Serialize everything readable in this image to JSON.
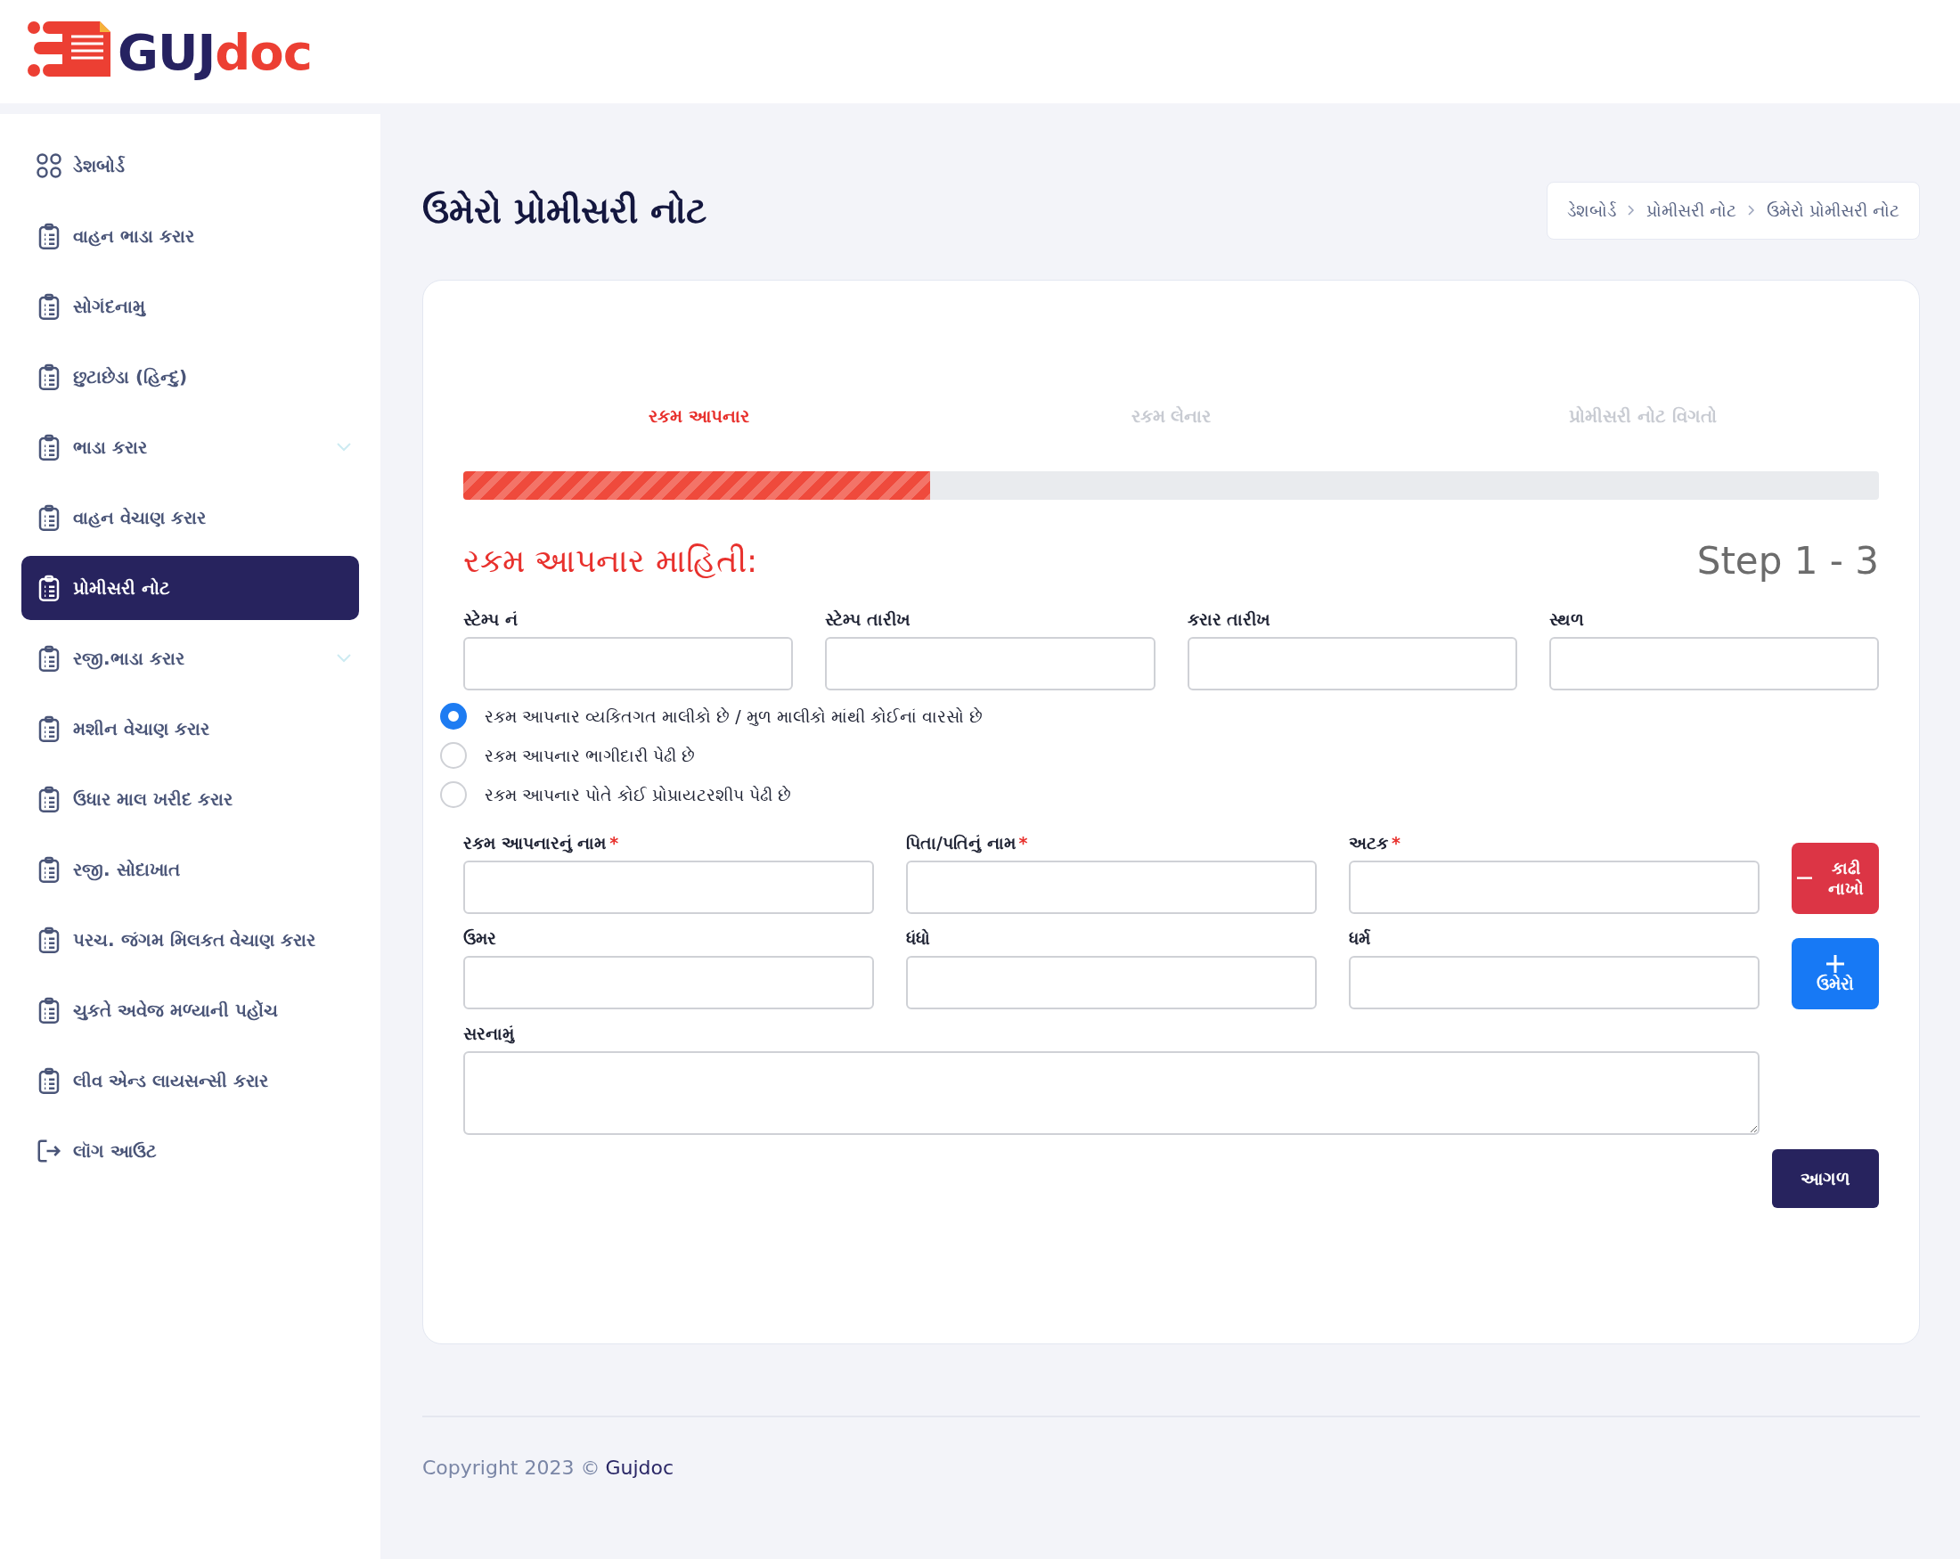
{
  "logo": {
    "part1": "GUJ",
    "part2": "doc"
  },
  "sidebar": {
    "items": [
      {
        "label": "ડેશબોર્ડ",
        "kind": "grid",
        "selected": false,
        "expandable": false
      },
      {
        "label": "વાહન ભાડા કરાર",
        "kind": "clipboard",
        "selected": false,
        "expandable": false
      },
      {
        "label": "સોગંદનામુ",
        "kind": "clipboard",
        "selected": false,
        "expandable": false
      },
      {
        "label": "છુટાછેડા (હિન્દુ)",
        "kind": "clipboard",
        "selected": false,
        "expandable": false
      },
      {
        "label": "ભાડા કરાર",
        "kind": "clipboard",
        "selected": false,
        "expandable": true
      },
      {
        "label": "વાહન વેચાણ કરાર",
        "kind": "clipboard",
        "selected": false,
        "expandable": false
      },
      {
        "label": "પ્રોમીસરી નોટ",
        "kind": "clipboard",
        "selected": true,
        "expandable": false
      },
      {
        "label": "રજી.ભાડા કરાર",
        "kind": "clipboard",
        "selected": false,
        "expandable": true
      },
      {
        "label": "મશીન વેચાણ કરાર",
        "kind": "clipboard",
        "selected": false,
        "expandable": false
      },
      {
        "label": "ઉધાર માલ ખરીદ કરાર",
        "kind": "clipboard",
        "selected": false,
        "expandable": false
      },
      {
        "label": "રજી. સોદાખાત",
        "kind": "clipboard",
        "selected": false,
        "expandable": false
      },
      {
        "label": "પરચ. જંગમ મિલકત વેચાણ કરાર",
        "kind": "clipboard",
        "selected": false,
        "expandable": false
      },
      {
        "label": "ચુકતે અવેજ મળ્યાની પહોંચ",
        "kind": "clipboard",
        "selected": false,
        "expandable": false
      },
      {
        "label": "લીવ એન્ડ લાયસન્સી કરાર",
        "kind": "clipboard",
        "selected": false,
        "expandable": false
      },
      {
        "label": "લૉગ આઉટ",
        "kind": "logout",
        "selected": false,
        "expandable": false
      }
    ]
  },
  "page_title": "ઉમેરો પ્રોમીસરી નોટ",
  "breadcrumb": [
    "ડેશબોર્ડ",
    "પ્રોમીસરી નોટ",
    "ઉમેરો પ્રોમીસરી નોટ"
  ],
  "steps": [
    {
      "label": "રકમ આપનાર",
      "selected": true
    },
    {
      "label": "રકમ લેનાર",
      "selected": false
    },
    {
      "label": "પ્રોમીસરી નોટ વિગતો",
      "selected": false
    }
  ],
  "progress": {
    "level": 0.33
  },
  "section_title": "રકમ આપનાર માહિતી:",
  "step_counter": "Step 1 - 3",
  "stamp_fields": [
    {
      "label": "સ્ટેમ્પ નં"
    },
    {
      "label": "સ્ટેમ્પ તારીખ"
    },
    {
      "label": "કરાર તારીખ"
    },
    {
      "label": "સ્થળ"
    }
  ],
  "radios": [
    {
      "label": "રકમ આપનાર વ્યકિતગત માલીકો છે / મુળ માલીકો માંથી કોઈનાં વારસો છે",
      "selected": true
    },
    {
      "label": "રકમ આપનાર ભાગીદારી પેઢી છે",
      "selected": false
    },
    {
      "label": "રકમ આપનાર પોતે કોઈ પ્રોપ્રાયટરશીપ પેઢી છે",
      "selected": false
    }
  ],
  "person_fields": [
    {
      "label": "રકમ આપનારનું નામ",
      "marker": "*"
    },
    {
      "label": "પિતા/પતિનું નામ",
      "marker": "*"
    },
    {
      "label": "અટક",
      "marker": "*"
    },
    {
      "label": "ઉમર"
    },
    {
      "label": "ધંધો"
    },
    {
      "label": "ધર્મ"
    }
  ],
  "remove_button": "કાઢી નાખો",
  "add_button": "ઉમેરો",
  "address_label": "સરનામું",
  "next_button": "આગળ",
  "footer": {
    "text": "Copyright 2023 ©",
    "brand": "Gujdoc"
  }
}
